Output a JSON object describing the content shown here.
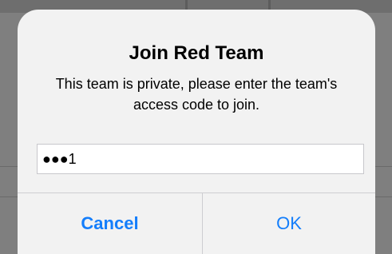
{
  "dialog": {
    "title": "Join Red Team",
    "message": "This team is private, please enter the team's access code to join.",
    "input": {
      "value": "●●●1",
      "type": "access-code"
    },
    "buttons": {
      "cancel_label": "Cancel",
      "ok_label": "OK"
    }
  },
  "colors": {
    "accent": "#147efb",
    "dialog_background": "#f2f2f2",
    "backdrop": "#7f7f7f"
  }
}
